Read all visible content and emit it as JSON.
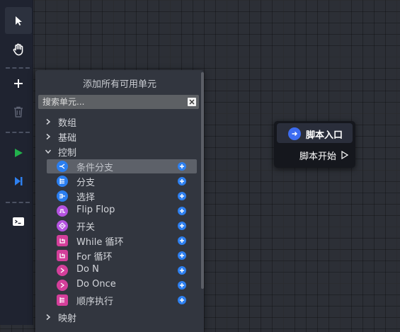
{
  "colors": {
    "canvas": "#2c2f36",
    "toolbar": "#1f2330",
    "panel": "#32363f",
    "accent_blue": "#2e80f0",
    "node_icon": "#3d6cf0",
    "play_green": "#22b14c"
  },
  "toolbar": {
    "tools": [
      {
        "name": "select-pointer-icon",
        "active": true
      },
      {
        "name": "hand-pan-icon",
        "active": false
      },
      {
        "name": "add-plus-icon",
        "active": false
      },
      {
        "name": "trash-icon",
        "active": false
      },
      {
        "name": "play-icon",
        "active": false
      },
      {
        "name": "step-icon",
        "active": false
      },
      {
        "name": "console-icon",
        "active": false
      }
    ]
  },
  "panel": {
    "title": "添加所有可用单元",
    "search_placeholder": "搜索单元...",
    "categories": [
      {
        "label": "数组",
        "expanded": false
      },
      {
        "label": "基础",
        "expanded": false
      },
      {
        "label": "控制",
        "expanded": true
      },
      {
        "label": "映射",
        "expanded": false
      }
    ],
    "items": [
      {
        "label": "条件分支",
        "icon": "branch-if-icon",
        "icon_color": "#2b7ff0",
        "selected": true
      },
      {
        "label": "分支",
        "icon": "switch-icon",
        "icon_color": "#2b7ff0",
        "selected": false
      },
      {
        "label": "选择",
        "icon": "select-icon",
        "icon_color": "#2b7ff0",
        "selected": false
      },
      {
        "label": "Flip Flop",
        "icon": "flip-flop-icon",
        "icon_color": "#b553e0",
        "selected": false
      },
      {
        "label": "开关",
        "icon": "gate-icon",
        "icon_color": "#b553e0",
        "selected": false
      },
      {
        "label": "While 循环",
        "icon": "while-loop-icon",
        "icon_color": "#d43f9a",
        "selected": false
      },
      {
        "label": "For 循环",
        "icon": "for-loop-icon",
        "icon_color": "#d43f9a",
        "selected": false
      },
      {
        "label": "Do N",
        "icon": "do-n-icon",
        "icon_color": "#d43f9a",
        "selected": false
      },
      {
        "label": "Do Once",
        "icon": "do-once-icon",
        "icon_color": "#d43f9a",
        "selected": false
      },
      {
        "label": "顺序执行",
        "icon": "sequence-icon",
        "icon_color": "#d43f9a",
        "selected": false
      }
    ]
  },
  "node": {
    "title": "脚本入口",
    "output_label": "脚本开始",
    "icon": "arrow-right-icon"
  }
}
